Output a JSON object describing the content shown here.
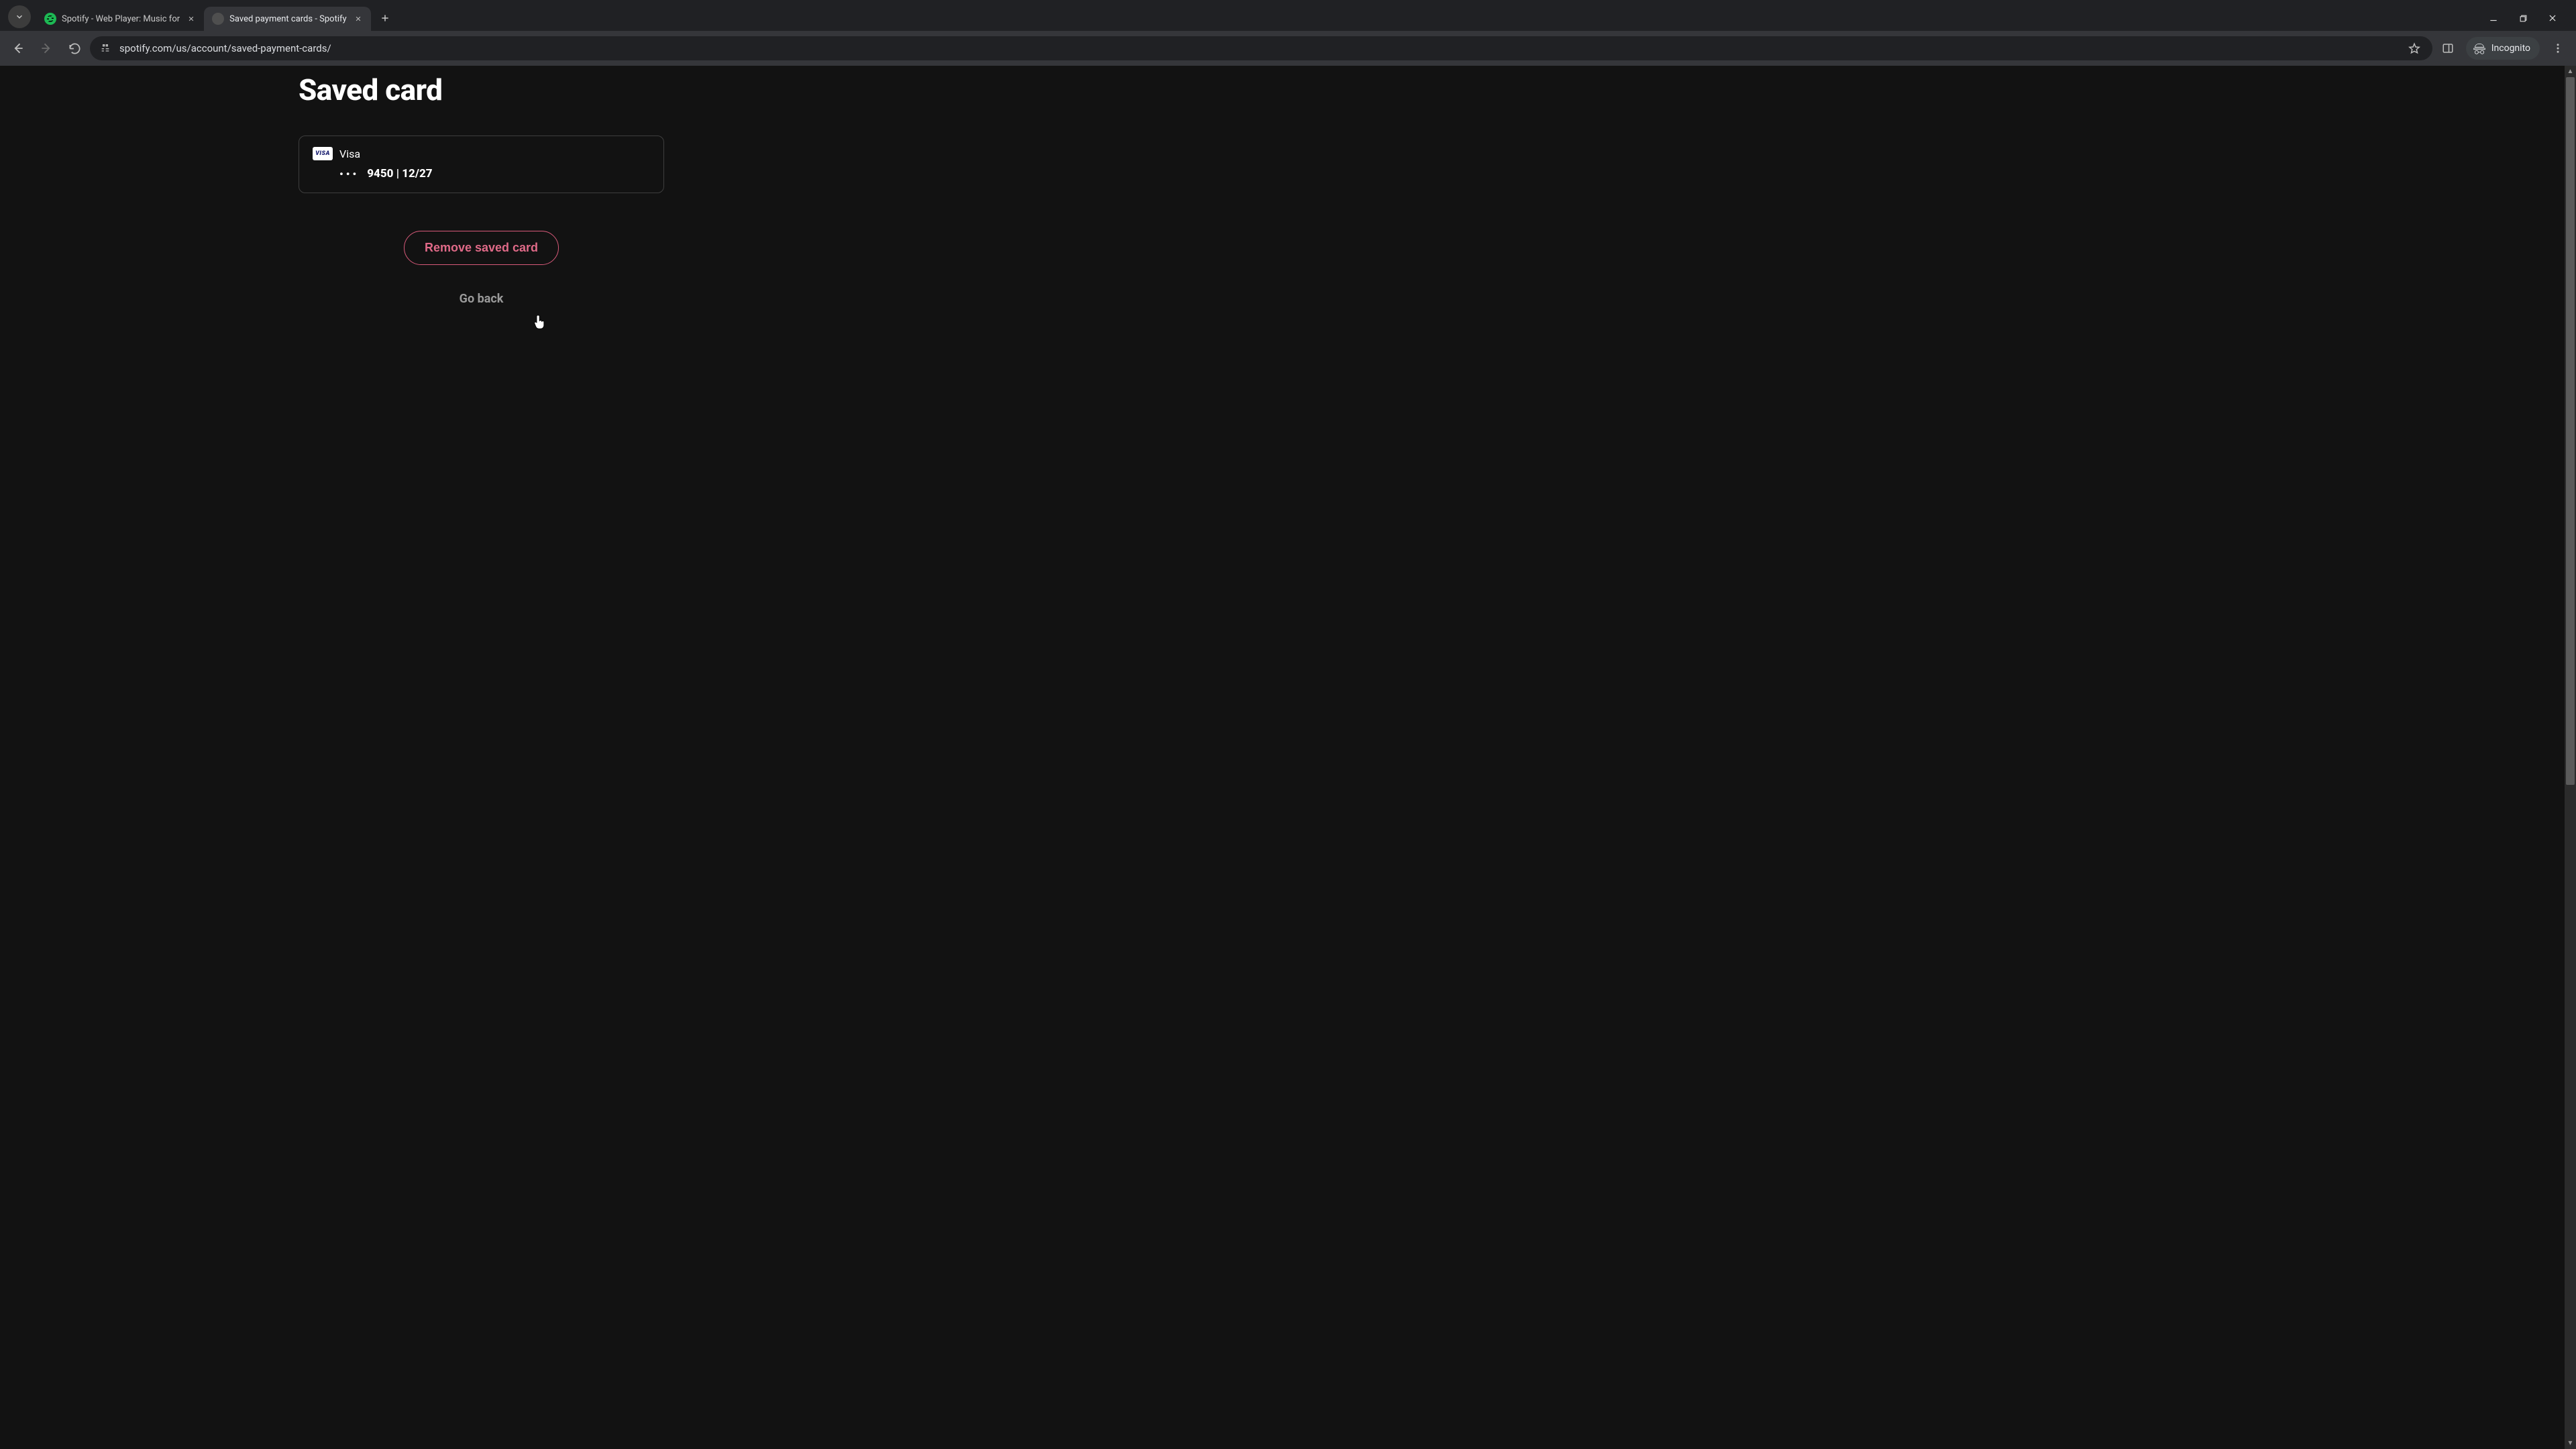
{
  "browser": {
    "tabs": [
      {
        "title": "Spotify - Web Player: Music for",
        "active": false
      },
      {
        "title": "Saved payment cards - Spotify",
        "active": true
      }
    ],
    "url": "spotify.com/us/account/saved-payment-cards/",
    "incognito_label": "Incognito"
  },
  "page": {
    "title": "Saved card",
    "card": {
      "brand": "Visa",
      "badge_text": "VISA",
      "masked_dots": "•••",
      "last4_and_expiry": "9450 | 12/27"
    },
    "remove_label": "Remove saved card",
    "goback_label": "Go back"
  }
}
